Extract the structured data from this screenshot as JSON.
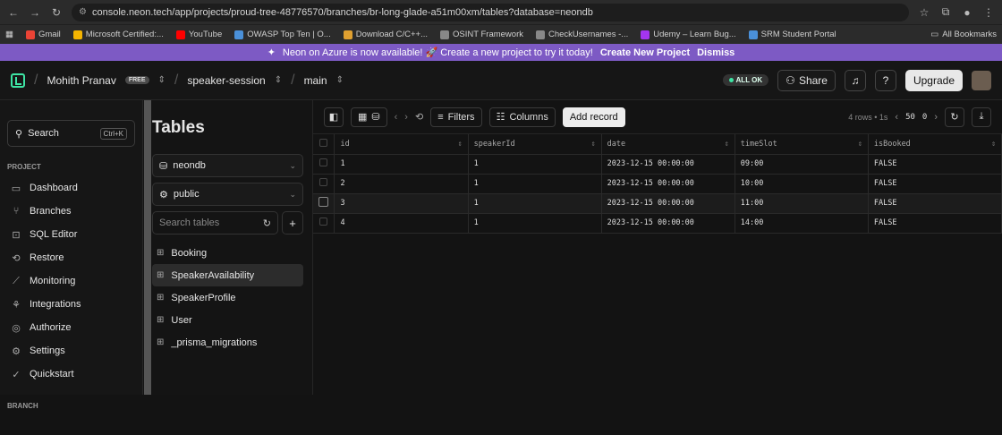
{
  "browser": {
    "url": "console.neon.tech/app/projects/proud-tree-48776570/branches/br-long-glade-a51m00xm/tables?database=neondb",
    "bookmarks": [
      "Gmail",
      "Microsoft Certified:...",
      "YouTube",
      "OWASP Top Ten | O...",
      "Download C/C++...",
      "OSINT Framework",
      "CheckUsernames -...",
      "Udemy – Learn Bug...",
      "SRM Student Portal"
    ],
    "all_bookmarks": "All Bookmarks"
  },
  "banner": {
    "text": "Neon on Azure is now available! 🚀 Create a new project to try it today!",
    "create": "Create New Project",
    "dismiss": "Dismiss"
  },
  "topbar": {
    "user": "Mohith Pranav",
    "plan": "FREE",
    "project": "speaker-session",
    "branch": "main",
    "status": "ALL OK",
    "share": "Share",
    "upgrade": "Upgrade"
  },
  "sidebar": {
    "search": "Search",
    "shortcut": "Ctrl+K",
    "section_project": "PROJECT",
    "items": [
      "Dashboard",
      "Branches",
      "SQL Editor",
      "Restore",
      "Monitoring",
      "Integrations",
      "Authorize",
      "Settings",
      "Quickstart"
    ],
    "section_branch": "BRANCH"
  },
  "tables_panel": {
    "title": "Tables",
    "database": "neondb",
    "schema": "public",
    "search_placeholder": "Search tables",
    "tables": [
      "Booking",
      "SpeakerAvailability",
      "SpeakerProfile",
      "User",
      "_prisma_migrations"
    ],
    "active_index": 1
  },
  "toolbar": {
    "filters": "Filters",
    "columns": "Columns",
    "add_record": "Add record",
    "rows_info": "4 rows • 1s",
    "page_size": "50",
    "page": "0"
  },
  "grid": {
    "columns": [
      "id",
      "speakerId",
      "date",
      "timeSlot",
      "isBooked"
    ],
    "rows": [
      [
        "1",
        "1",
        "2023-12-15 00:00:00",
        "09:00",
        "FALSE"
      ],
      [
        "2",
        "1",
        "2023-12-15 00:00:00",
        "10:00",
        "FALSE"
      ],
      [
        "3",
        "1",
        "2023-12-15 00:00:00",
        "11:00",
        "FALSE"
      ],
      [
        "4",
        "1",
        "2023-12-15 00:00:00",
        "14:00",
        "FALSE"
      ]
    ],
    "highlight_row": 2
  }
}
